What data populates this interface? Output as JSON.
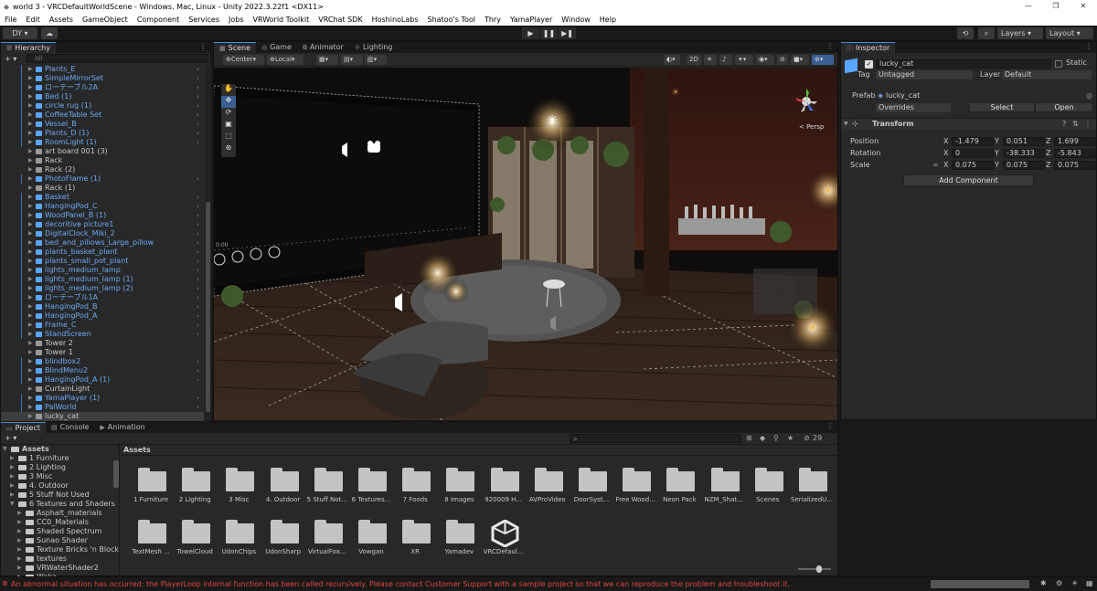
{
  "window": {
    "title": "world 3 - VRCDefaultWorldScene - Windows, Mac, Linux - Unity 2022.3.22f1 <DX11>",
    "minimize": "—",
    "maximize": "❐",
    "close": "✕"
  },
  "menu": [
    "File",
    "Edit",
    "Assets",
    "GameObject",
    "Component",
    "Services",
    "Jobs",
    "VRWorld Toolkit",
    "VRChat SDK",
    "HoshinoLabs",
    "Shatoo's Tool",
    "Thry",
    "YamaPlayer",
    "Window",
    "Help"
  ],
  "toolbar": {
    "account": "DY ▾",
    "play": "▶",
    "pause": "❚❚",
    "step": "▶❚",
    "layers": "Layers",
    "layout": "Layout"
  },
  "hierarchy": {
    "tab": "Hierarchy",
    "add": "+ ▾",
    "search_placeholder": "All",
    "items": [
      {
        "name": "Plants_E",
        "blue": true
      },
      {
        "name": "SimpleMirrorSet",
        "blue": true
      },
      {
        "name": "ローテーブル2A",
        "blue": true
      },
      {
        "name": "Bed (1)",
        "blue": true
      },
      {
        "name": "circle rug (1)",
        "blue": true
      },
      {
        "name": "CoffeeTable Set",
        "blue": true
      },
      {
        "name": "Vessel_B",
        "blue": true
      },
      {
        "name": "Plants_D (1)",
        "blue": true
      },
      {
        "name": "RoomLight (1)",
        "blue": true
      },
      {
        "name": "art board 001 (3)",
        "blue": false
      },
      {
        "name": "Rack",
        "blue": false
      },
      {
        "name": "Rack (2)",
        "blue": false
      },
      {
        "name": "PhotoFlame (1)",
        "blue": true
      },
      {
        "name": "Rack (1)",
        "blue": false
      },
      {
        "name": "Basket",
        "blue": true
      },
      {
        "name": "HangingPod_C",
        "blue": true
      },
      {
        "name": "WoodPanel_B (1)",
        "blue": true
      },
      {
        "name": "decoritive picture1",
        "blue": true
      },
      {
        "name": "DigitalClock_Miki_2",
        "blue": true
      },
      {
        "name": "bed_and_pillows_Large_pillow",
        "blue": true
      },
      {
        "name": "plants_basket_plant",
        "blue": true
      },
      {
        "name": "plants_small_pot_plant",
        "blue": true
      },
      {
        "name": "lights_medium_lamp",
        "blue": true
      },
      {
        "name": "lights_medium_lamp (1)",
        "blue": true
      },
      {
        "name": "lights_medium_lamp (2)",
        "blue": true
      },
      {
        "name": "ローテーブル1A",
        "blue": true
      },
      {
        "name": "HangingPod_B",
        "blue": true
      },
      {
        "name": "HangingPod_A",
        "blue": true
      },
      {
        "name": "Frame_C",
        "blue": true
      },
      {
        "name": "StandScreen",
        "blue": true
      },
      {
        "name": "Tower 2",
        "blue": false
      },
      {
        "name": "Tower 1",
        "blue": false
      },
      {
        "name": "blindbox2",
        "blue": true
      },
      {
        "name": "BlindMenu2",
        "blue": true
      },
      {
        "name": "HangingPod_A (1)",
        "blue": true
      },
      {
        "name": "CurtainLight",
        "blue": false
      },
      {
        "name": "YamaPlayer (1)",
        "blue": true
      },
      {
        "name": "PalWorld",
        "blue": true
      },
      {
        "name": "lucky_cat",
        "blue": false
      }
    ]
  },
  "scene": {
    "tabs": [
      "Scene",
      "Game",
      "Animator",
      "Lighting"
    ],
    "pivot": "Center",
    "space": "Local",
    "mode2d": "2D",
    "persp": "< Persp",
    "video_time": "0:00"
  },
  "inspector": {
    "tab": "Inspector",
    "object_name": "lucky_cat",
    "static": "Static",
    "tag_label": "Tag",
    "tag": "Untagged",
    "layer_label": "Layer",
    "layer": "Default",
    "prefab_label": "Prefab",
    "prefab": "lucky_cat",
    "overrides": "Overrides",
    "select": "Select",
    "open": "Open",
    "transform": "Transform",
    "position_label": "Position",
    "rotation_label": "Rotation",
    "scale_label": "Scale",
    "position": {
      "x": "-1.479",
      "y": "0.051",
      "z": "1.699"
    },
    "rotation": {
      "x": "0",
      "y": "-38.333",
      "z": "-5.843"
    },
    "scale": {
      "x": "0.075",
      "y": "0.075",
      "z": "0.075"
    },
    "axis": {
      "x": "X",
      "y": "Y",
      "z": "Z"
    },
    "add_component": "Add Component"
  },
  "project": {
    "tabs": [
      "Project",
      "Console",
      "Animation"
    ],
    "add": "+ ▾",
    "hidden_count": "29",
    "breadcrumb": "Assets",
    "tree": [
      {
        "name": "Assets",
        "level": 0,
        "open": true,
        "bold": true
      },
      {
        "name": "1 Furniture",
        "level": 1
      },
      {
        "name": "2 Lighting",
        "level": 1
      },
      {
        "name": "3 Misc",
        "level": 1
      },
      {
        "name": "4. Outdoor",
        "level": 1
      },
      {
        "name": "5 Stuff Not Used",
        "level": 1
      },
      {
        "name": "6  Textures and Shaders",
        "level": 1,
        "open": true
      },
      {
        "name": "Asphalt_materials",
        "level": 2
      },
      {
        "name": "CC0_Materials",
        "level": 2
      },
      {
        "name": "Shaded Spectrum",
        "level": 2
      },
      {
        "name": "Sunao Shader",
        "level": 2
      },
      {
        "name": "Texture Bricks 'n Blocks",
        "level": 2
      },
      {
        "name": "textures",
        "level": 2
      },
      {
        "name": "VRWaterShader2",
        "level": 2
      },
      {
        "name": "Waka",
        "level": 2
      }
    ],
    "assets_row1": [
      "1 Furniture",
      "2 Lighting",
      "3 Misc",
      "4. Outdoor",
      "5 Stuff Not...",
      "6  Textures...",
      "7 Foods",
      "8 Images",
      "920009 H...",
      "AVProVideo",
      "DoorSyst...",
      "Free Wood...",
      "Neon Pack",
      "NZM_Shat...",
      "Scenes",
      "SerializedU..."
    ],
    "assets_row2": [
      "TextMesh ...",
      "TowelCloud",
      "UdonChips",
      "UdonSharp",
      "VirtualFox...",
      "Vowgan",
      "XR",
      "Yamadev",
      "VRCDefaul..."
    ]
  },
  "status": {
    "message": "An abnormal situation has occurred: the PlayerLoop internal function has been called recursively. Please contact Customer Support with a sample project so that we can reproduce the problem and troubleshoot it."
  },
  "colors": {
    "accent": "#4a8fe0",
    "prefab_blue": "#6aa9f5",
    "error_red": "#e04545"
  }
}
